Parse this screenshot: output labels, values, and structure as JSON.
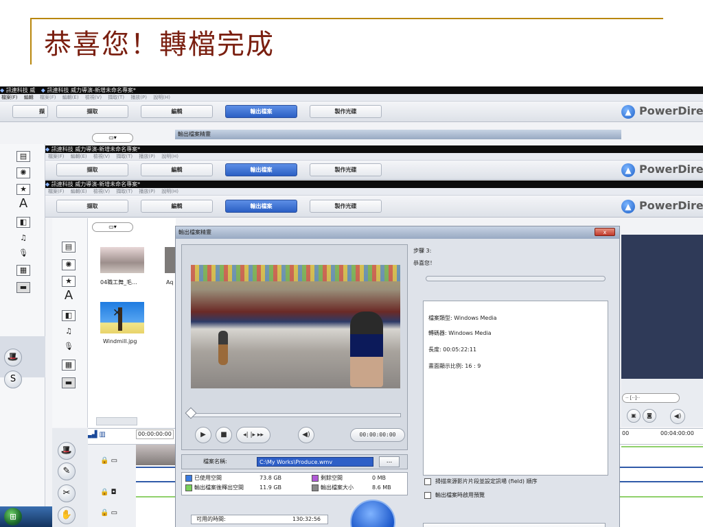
{
  "slide": {
    "title": "恭喜您！轉檔完成"
  },
  "window": {
    "title_back_left": "訊連科技 威",
    "title": "訊連科技 威力導演-新增未命名專案*",
    "menu": [
      "檔案(F)",
      "編輯(E)",
      "檢視(V)",
      "擷取(T)",
      "播放(P)",
      "說明(H)"
    ],
    "menu_back_left": [
      "檔案(F)",
      "編輯"
    ],
    "toolbar": {
      "capture": "擷取",
      "edit": "編輯",
      "produce": "輸出檔案",
      "disc": "製作光碟"
    },
    "logo": "PowerDire"
  },
  "dialog": {
    "title": "輸出檔案精靈",
    "close": "x",
    "step": "步驟 3:",
    "congrats": "恭喜您！",
    "info": {
      "file_type": "檔案類型: Windows Media",
      "encoder": "轉碼器: Windows Media",
      "length": "長度: 00:05:22:11",
      "aspect": "畫面顯示比例: 16 : 9"
    },
    "timecode": "00:00:00:00",
    "filename_label": "檔案名稱:",
    "filename_value": "C:\\My Works\\Produce.wmv",
    "browse": "...",
    "space": {
      "used_label": "已使用空間",
      "used_value": "73.8 GB",
      "free_label": "剩餘空間",
      "free_value": "0 MB",
      "after_label": "輸出檔案後釋出空間",
      "after_value": "11.9 GB",
      "size_label": "輸出檔案大小",
      "size_value": "8.6 MB"
    },
    "time_label": "可用的時間:",
    "time_value": "130:32:56",
    "option_field": "掃描來源影片片段並設定訊場 (field) 順序",
    "option_preview": "輸出檔案時啟用預覽"
  },
  "library": {
    "clip1": "04職工舞_毛...",
    "clip2": "Windmill.jpg",
    "clip3": "Aq"
  },
  "timeline": {
    "t0": "00:00:00:00",
    "t4": "00:04:00:00",
    "t_right_partial": "00"
  },
  "colors": {
    "accent_line": "#b8860b",
    "title": "#7a1f10",
    "produce_active": "#2b5fc4",
    "timeline_blue": "#2f5aa8"
  }
}
